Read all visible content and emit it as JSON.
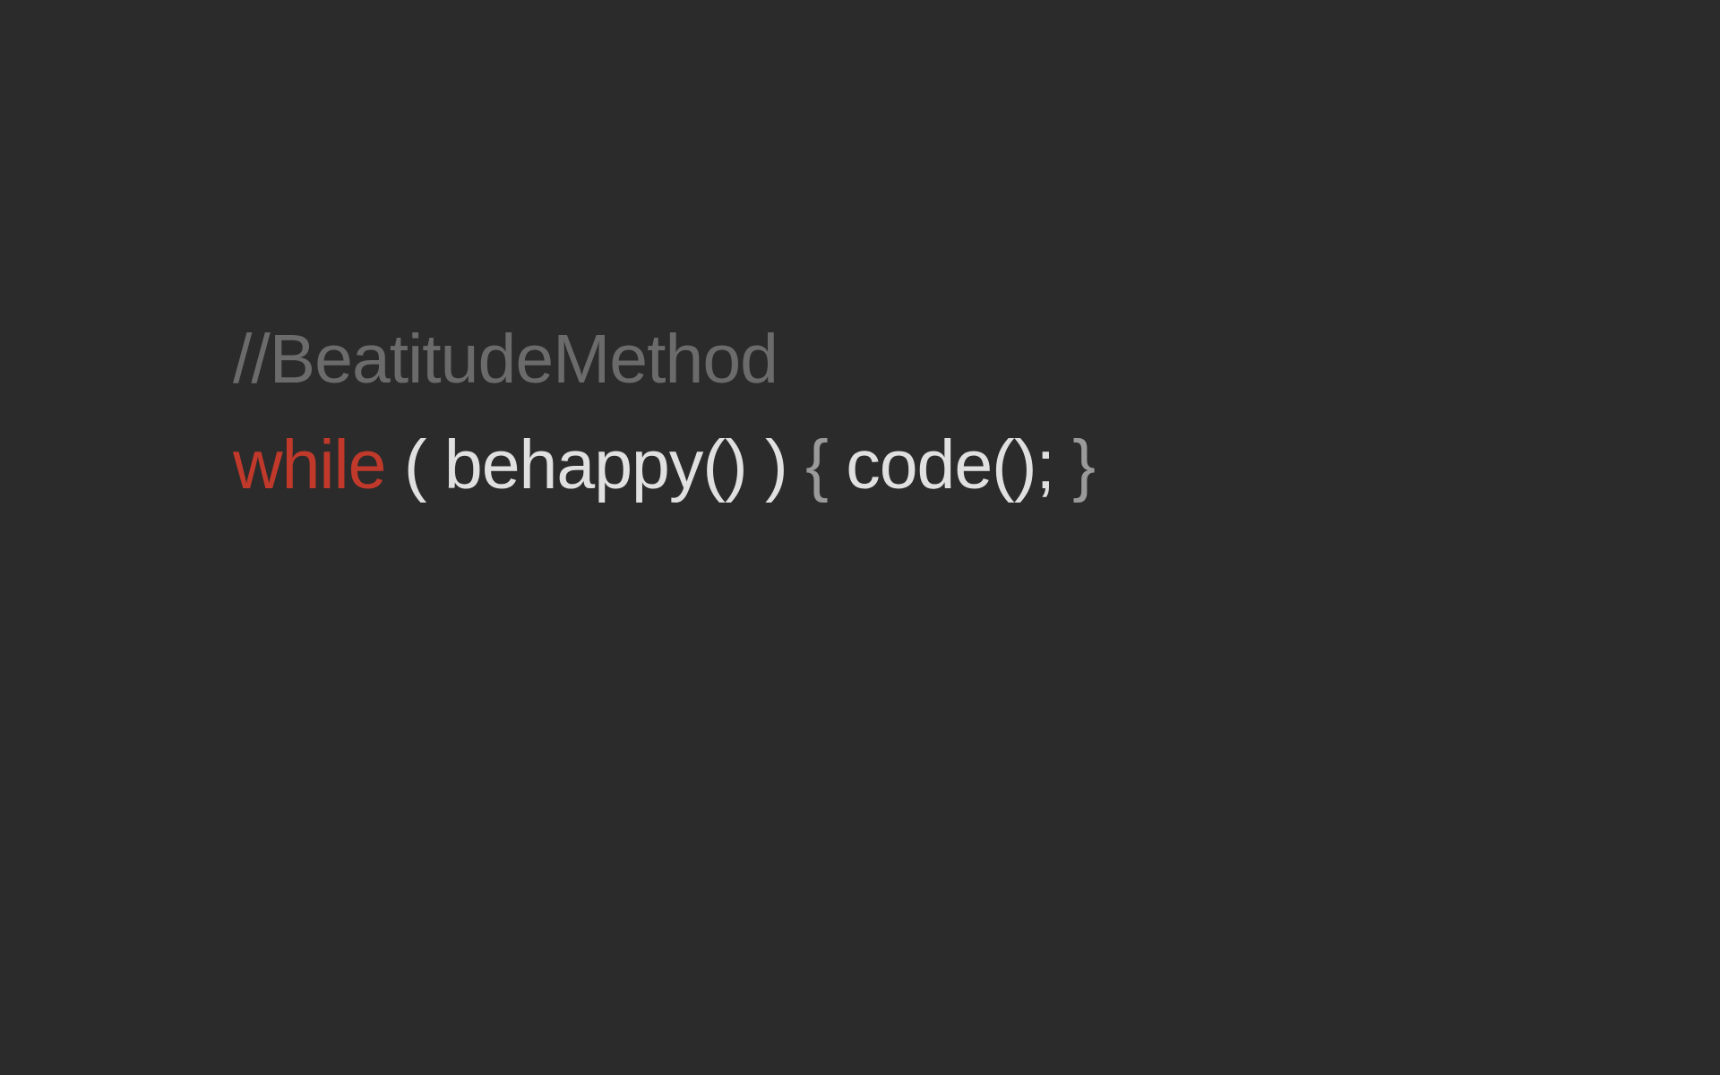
{
  "comment": "//BeatitudeMethod",
  "keyword": "while",
  "segment_open_paren": " ( ",
  "segment_condition": "behappy()",
  "segment_close_paren": " ) ",
  "segment_open_brace": "{ ",
  "segment_body": "code();",
  "segment_close_brace": " }"
}
